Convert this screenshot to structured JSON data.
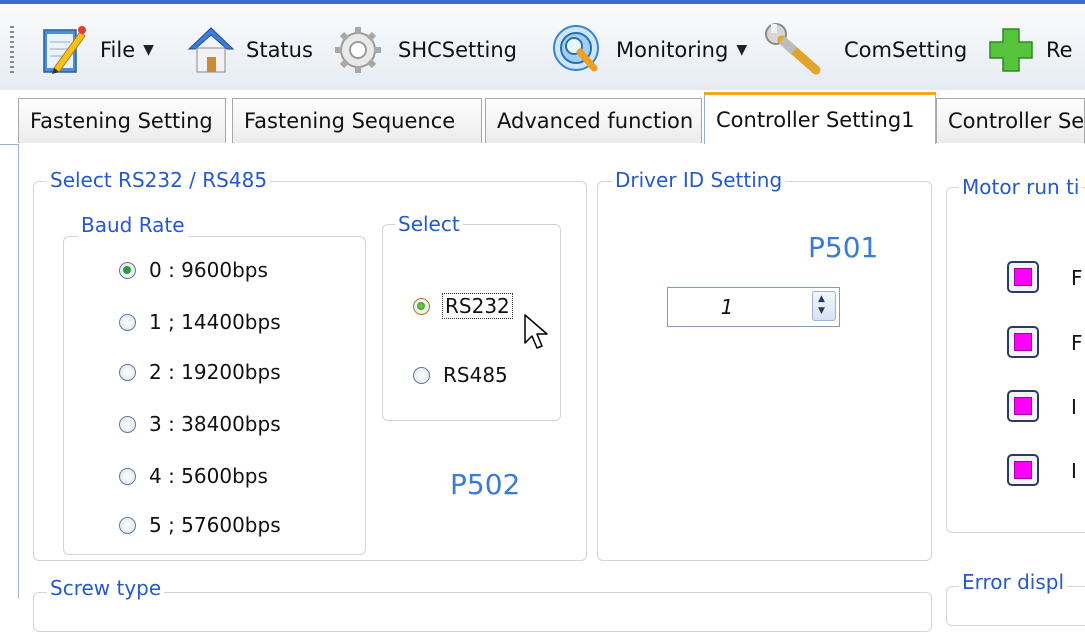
{
  "toolbar": {
    "items": [
      {
        "label": "File",
        "icon": "notepad-pencil-icon",
        "has_dropdown": true
      },
      {
        "label": "Status",
        "icon": "house-icon",
        "has_dropdown": false
      },
      {
        "label": "SHCSetting",
        "icon": "gear-icon",
        "has_dropdown": false
      },
      {
        "label": "Monitoring",
        "icon": "magnifier-icon",
        "has_dropdown": true
      },
      {
        "label": "ComSetting",
        "icon": "wrench-icon",
        "has_dropdown": false
      },
      {
        "label": "Re",
        "icon": "green-plus-icon",
        "has_dropdown": false
      }
    ]
  },
  "tabs": [
    {
      "label": "Fastening Setting",
      "active": false
    },
    {
      "label": "Fastening Sequence",
      "active": false
    },
    {
      "label": "Advanced function",
      "active": false
    },
    {
      "label": "Controller Setting1",
      "active": true
    },
    {
      "label": "Controller Se",
      "active": false
    }
  ],
  "rs_group": {
    "title": "Select RS232 / RS485",
    "baud": {
      "title": "Baud Rate",
      "options": [
        {
          "label": "0 : 9600bps",
          "checked": true
        },
        {
          "label": "1 ; 14400bps",
          "checked": false
        },
        {
          "label": "2 : 19200bps",
          "checked": false
        },
        {
          "label": "3 : 38400bps",
          "checked": false
        },
        {
          "label": "4 : 5600bps",
          "checked": false
        },
        {
          "label": "5 ; 57600bps",
          "checked": false
        }
      ]
    },
    "select": {
      "title": "Select",
      "options": [
        {
          "label": "RS232",
          "checked": true
        },
        {
          "label": "RS485",
          "checked": false
        }
      ]
    },
    "param_code": "P502"
  },
  "driver_id": {
    "title": "Driver ID Setting",
    "param_code": "P501",
    "value": "1"
  },
  "motor_run": {
    "title": "Motor run ti",
    "items": [
      {
        "label": "F",
        "checked": true
      },
      {
        "label": "F",
        "checked": true
      },
      {
        "label": "I",
        "checked": true
      },
      {
        "label": "I",
        "checked": true
      }
    ],
    "checked_color": "#ff00ff"
  },
  "screw_type": {
    "title": "Screw type"
  },
  "error_display": {
    "title": "Error displ"
  },
  "colors": {
    "accent": "#2659c9",
    "param": "#3a7ad9",
    "tab_highlight": "#f5a623"
  }
}
